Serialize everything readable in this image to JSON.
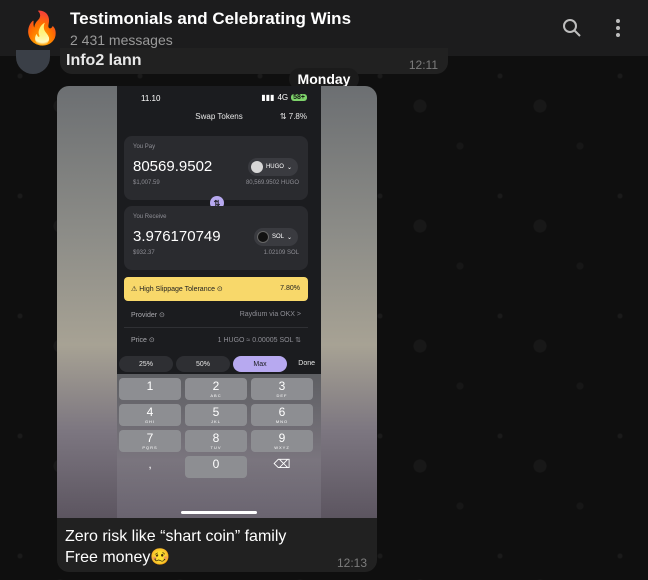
{
  "header": {
    "emoji": "🔥",
    "title": "Testimonials and Celebrating Wins",
    "subtitle": "2 431 messages",
    "icons": [
      "search-icon",
      "more-vertical-icon"
    ]
  },
  "prev_message": {
    "name": "Info2 lann",
    "time": "12:11"
  },
  "day_separator": "Monday",
  "message": {
    "caption_line1": "Zero risk like “shart coin” family",
    "caption_line2": "Free money🥴",
    "time": "12:13",
    "screenshot": {
      "status_time": "11.10",
      "status_network": "4G",
      "status_battery": "58+",
      "screen_title": "Swap Tokens",
      "slippage_top": "⇅ 7.8%",
      "pay": {
        "label": "You Pay",
        "amount": "80569.9502",
        "token": "HUGO",
        "usd": "$1,007.59",
        "balance": "80,569.9502 HUGO"
      },
      "receive": {
        "label": "You Receive",
        "amount": "3.976170749",
        "token": "SOL",
        "usd": "$932.37",
        "balance": "1.02109 SOL"
      },
      "warning_label": "⚠ High Slippage Tolerance ⊙",
      "warning_value": "7.80%",
      "provider_label": "Provider ⊙",
      "provider_value": "Raydium via OKX >",
      "price_label": "Price ⊙",
      "price_value": "1 HUGO ≈ 0.00005 SOL ⇅",
      "percent_buttons": [
        "25%",
        "50%",
        "Max"
      ],
      "done_label": "Done",
      "keys": [
        {
          "n": "1",
          "s": ""
        },
        {
          "n": "2",
          "s": "ABC"
        },
        {
          "n": "3",
          "s": "DEF"
        },
        {
          "n": "4",
          "s": "GHI"
        },
        {
          "n": "5",
          "s": "JKL"
        },
        {
          "n": "6",
          "s": "MNO"
        },
        {
          "n": "7",
          "s": "PQRS"
        },
        {
          "n": "8",
          "s": "TUV"
        },
        {
          "n": "9",
          "s": "WXYZ"
        },
        {
          "n": ",",
          "s": ""
        },
        {
          "n": "0",
          "s": ""
        },
        {
          "n": "⌫",
          "s": ""
        }
      ]
    }
  }
}
